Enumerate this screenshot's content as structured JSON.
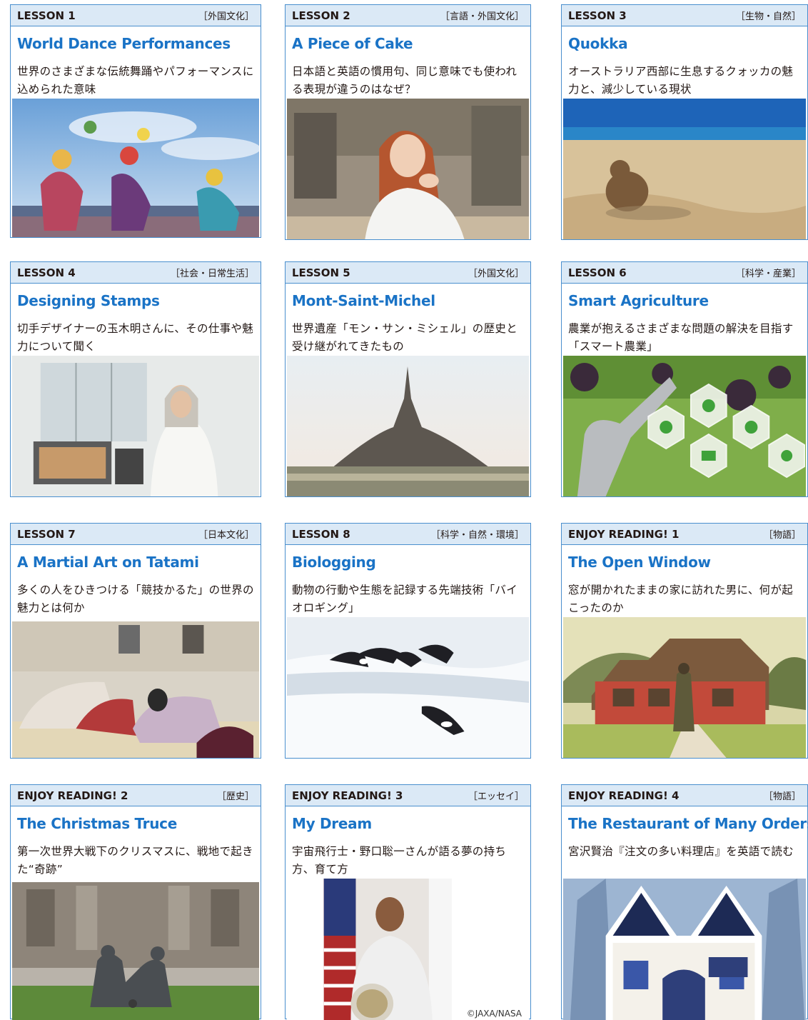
{
  "cards": [
    {
      "lesson": "LESSON 1",
      "category": "［外国文化］",
      "title": "World Dance Performances",
      "desc": "世界のさまざまな伝統舞踊やパフォーマンスに込められた意味"
    },
    {
      "lesson": "LESSON 2",
      "category": "［言語・外国文化］",
      "title": "A Piece of Cake",
      "desc": "日本語と英語の慣用句、同じ意味でも使われる表現が違うのはなぜ？"
    },
    {
      "lesson": "LESSON 3",
      "category": "［生物・自然］",
      "title": "Quokka",
      "desc": "オーストラリア西部に生息するクォッカの魅力と、減少している現状"
    },
    {
      "lesson": "LESSON 4",
      "category": "［社会・日常生活］",
      "title": "Designing Stamps",
      "desc": "切手デザイナーの玉木明さんに、その仕事や魅力について聞く"
    },
    {
      "lesson": "LESSON 5",
      "category": "［外国文化］",
      "title": "Mont-Saint-Michel",
      "desc": "世界遺産「モン・サン・ミシェル」の歴史と受け継がれてきたもの"
    },
    {
      "lesson": "LESSON 6",
      "category": "［科学・産業］",
      "title": "Smart Agriculture",
      "desc": "農業が抱えるさまざまな問題の解決を目指す「スマート農業」"
    },
    {
      "lesson": "LESSON 7",
      "category": "［日本文化］",
      "title": "A Martial Art on Tatami",
      "desc": "多くの人をひきつける「競技かるた」の世界の魅力とは何か"
    },
    {
      "lesson": "LESSON 8",
      "category": "［科学・自然・環境］",
      "title": "Biologging",
      "desc": "動物の行動や生態を記録する先端技術「バイオロギング」"
    },
    {
      "lesson": "ENJOY READING! 1",
      "category": "［物語］",
      "title": "The Open Window",
      "desc": "窓が開かれたままの家に訪れた男に、何が起こったのか"
    },
    {
      "lesson": "ENJOY READING! 2",
      "category": "［歴史］",
      "title": "The Christmas Truce",
      "desc": "第一次世界大戦下のクリスマスに、戦地で起きた“奇跡”"
    },
    {
      "lesson": "ENJOY READING! 3",
      "category": "［エッセイ］",
      "title": "My Dream",
      "desc": "宇宙飛行士・野口聡一さんが語る夢の持ち方、育て方",
      "credit": "©JAXA/NASA"
    },
    {
      "lesson": "ENJOY READING! 4",
      "category": "［物語］",
      "title": "The Restaurant of Many Orders",
      "desc": "宮沢賢治『注文の多い料理店』を英語で読む"
    }
  ],
  "colors": {
    "border": "#4a8fce",
    "header_bg": "#dbe9f6",
    "title": "#1a73c6"
  }
}
